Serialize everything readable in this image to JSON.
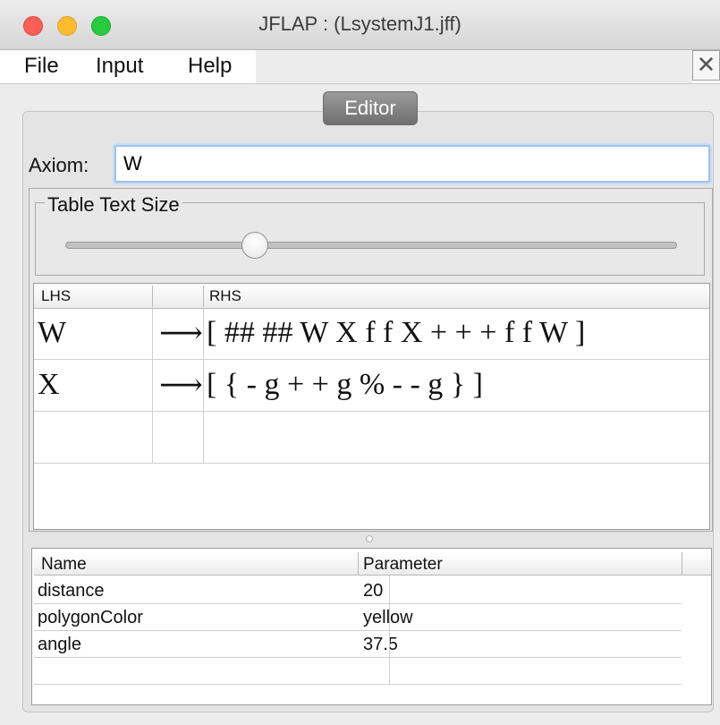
{
  "window": {
    "title": "JFLAP : (LsystemJ1.jff)"
  },
  "menu": {
    "file": "File",
    "input": "Input",
    "help": "Help",
    "close_symbol": "✕"
  },
  "tabs": {
    "editor": "Editor"
  },
  "axiom": {
    "label": "Axiom:",
    "value": "W"
  },
  "table_text_size": {
    "legend": "Table Text Size",
    "slider_level": 0.31
  },
  "rules": {
    "headers": {
      "lhs": "LHS",
      "rhs": "RHS"
    },
    "arrow": "⟶",
    "rows": [
      {
        "lhs": "W",
        "rhs": "[ ## ## W X f f X + + + f f W ]"
      },
      {
        "lhs": "X",
        "rhs": "[ { - g + + g % - - g } ]"
      },
      {
        "lhs": "",
        "rhs": ""
      }
    ]
  },
  "parameters": {
    "headers": {
      "name": "Name",
      "parameter": "Parameter"
    },
    "rows": [
      {
        "name": "distance",
        "value": "20"
      },
      {
        "name": "polygonColor",
        "value": "yellow"
      },
      {
        "name": "angle",
        "value": "37.5"
      },
      {
        "name": "",
        "value": ""
      }
    ]
  },
  "colors": {
    "focus_ring": "#9ec2ec",
    "tab_bg": "#7f7f7f"
  },
  "icons": {
    "close": "close-icon",
    "window_close": "traffic-red",
    "window_minimize": "traffic-yellow",
    "window_zoom": "traffic-green"
  }
}
